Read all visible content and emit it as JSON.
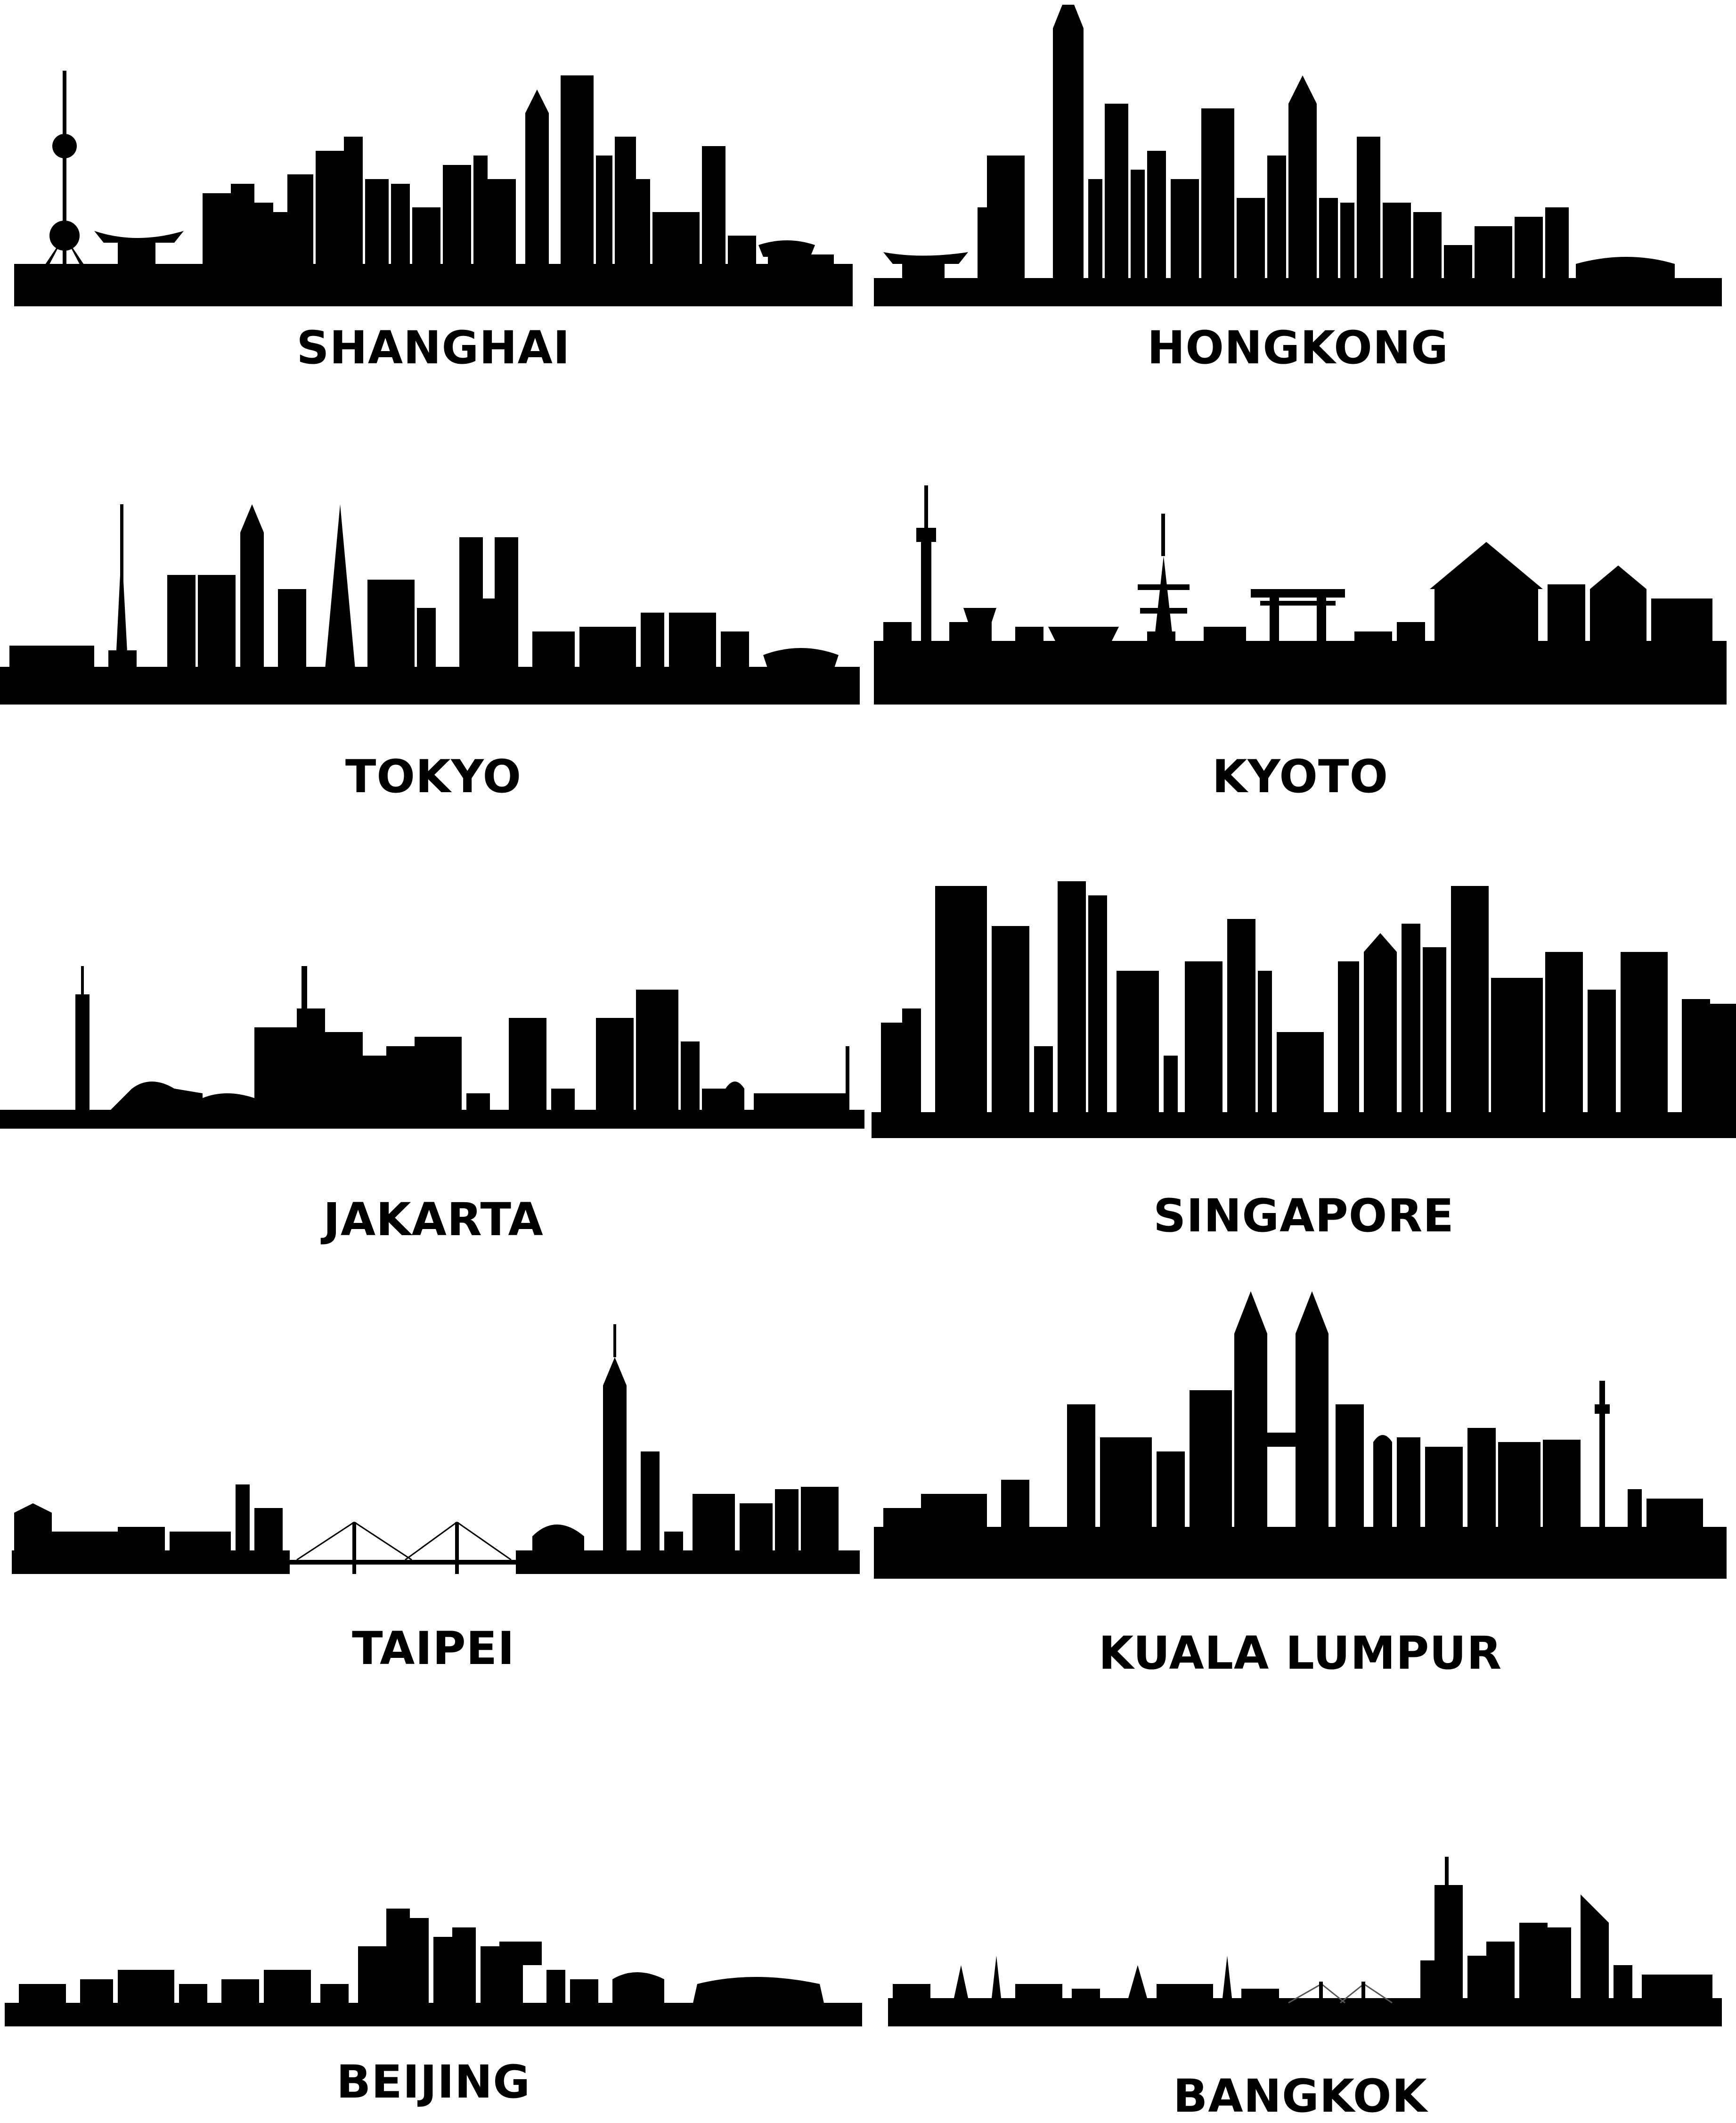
{
  "colors": {
    "background": "#ffffff",
    "silhouette": "#000000"
  },
  "cities": [
    {
      "id": "shanghai",
      "label": "SHANGHAI"
    },
    {
      "id": "hongkong",
      "label": "HONGKONG"
    },
    {
      "id": "tokyo",
      "label": "TOKYO"
    },
    {
      "id": "kyoto",
      "label": "KYOTO"
    },
    {
      "id": "jakarta",
      "label": "JAKARTA"
    },
    {
      "id": "singapore",
      "label": "SINGAPORE"
    },
    {
      "id": "taipei",
      "label": "TAIPEI"
    },
    {
      "id": "kuala_lumpur",
      "label": "KUALA LUMPUR"
    },
    {
      "id": "beijing",
      "label": "BEIJING"
    },
    {
      "id": "bangkok",
      "label": "BANGKOK"
    }
  ]
}
